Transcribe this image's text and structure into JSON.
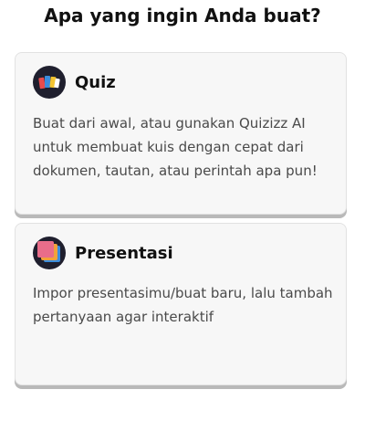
{
  "page": {
    "title": "Apa yang ingin Anda buat?"
  },
  "cards": [
    {
      "title": "Quiz",
      "description": "Buat dari awal, atau gunakan Quizizz AI untuk membuat kuis dengan cepat dari dokumen, tautan, atau perintah apa pun!",
      "icon": "quiz-icon"
    },
    {
      "title": "Presentasi",
      "description": "Impor presentasimu/buat baru, lalu tambah pertanyaan agar interaktif",
      "icon": "presentation-icon"
    }
  ],
  "colors": {
    "card_background": "#f7f7f7",
    "card_shadow": "#b9b9b9",
    "icon_dark": "#1f1f2e",
    "icon_red": "#e84c4c",
    "icon_blue": "#3a8dde",
    "icon_yellow": "#f4c430",
    "icon_pink": "#e96d8a",
    "icon_orange": "#f2a23a"
  }
}
